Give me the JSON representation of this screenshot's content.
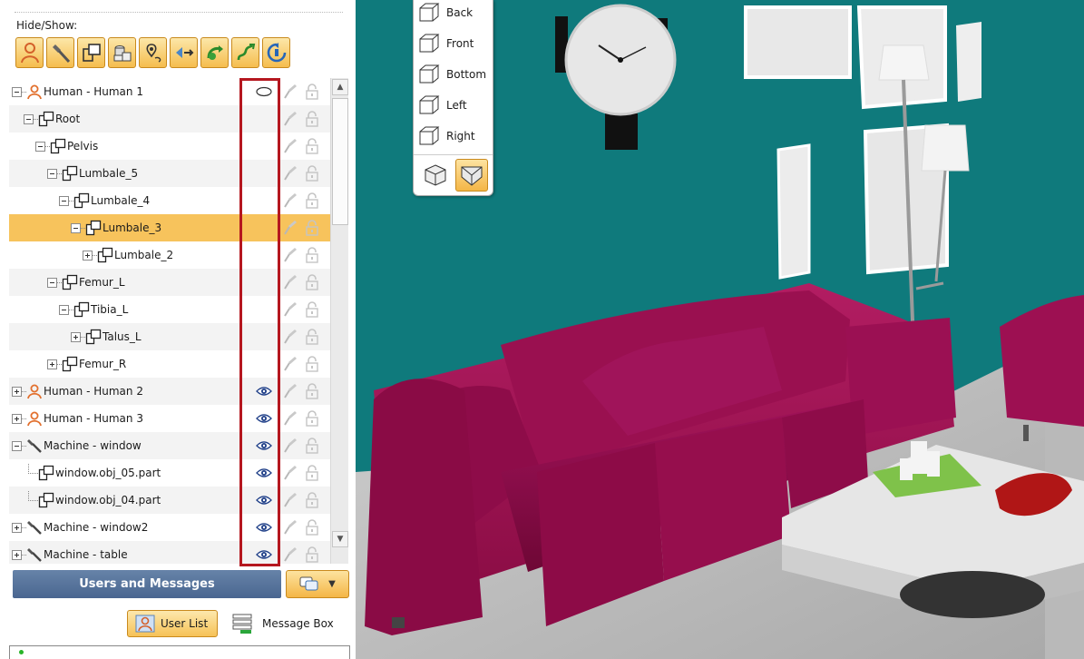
{
  "panel": {
    "hide_show_label": "Hide/Show:",
    "filter_buttons": [
      "human-filter",
      "machine-filter",
      "part-filter",
      "group-filter",
      "location-filter",
      "arrow-filter",
      "motion-filter",
      "path-filter",
      "rotate-filter"
    ]
  },
  "tree": {
    "rows": [
      {
        "label": "Human - Human 1",
        "icon": "human-icon",
        "expander": "minus",
        "vis": "hidden"
      },
      {
        "label": "Root",
        "icon": "part-icon",
        "expander": "minus",
        "vis": "none"
      },
      {
        "label": "Pelvis",
        "icon": "part-icon",
        "expander": "minus",
        "vis": "none"
      },
      {
        "label": "Lumbale_5",
        "icon": "part-icon",
        "expander": "minus",
        "vis": "none"
      },
      {
        "label": "Lumbale_4",
        "icon": "part-icon",
        "expander": "minus",
        "vis": "none"
      },
      {
        "label": "Lumbale_3",
        "icon": "part-icon",
        "expander": "minus",
        "vis": "none",
        "selected": true
      },
      {
        "label": "Lumbale_2",
        "icon": "part-icon",
        "expander": "plus",
        "vis": "none"
      },
      {
        "label": "Femur_L",
        "icon": "part-icon",
        "expander": "minus",
        "vis": "none"
      },
      {
        "label": "Tibia_L",
        "icon": "part-icon",
        "expander": "minus",
        "vis": "none"
      },
      {
        "label": "Talus_L",
        "icon": "part-icon",
        "expander": "plus",
        "vis": "none"
      },
      {
        "label": "Femur_R",
        "icon": "part-icon",
        "expander": "plus",
        "vis": "none"
      },
      {
        "label": "Human - Human 2",
        "icon": "human-icon",
        "expander": "plus",
        "vis": "eye"
      },
      {
        "label": "Human - Human 3",
        "icon": "human-icon",
        "expander": "plus",
        "vis": "eye"
      },
      {
        "label": "Machine - window",
        "icon": "machine-icon",
        "expander": "minus",
        "vis": "eye"
      },
      {
        "label": "window.obj_05.part",
        "icon": "part-icon",
        "expander": "none",
        "vis": "eye"
      },
      {
        "label": "window.obj_04.part",
        "icon": "part-icon",
        "expander": "none",
        "vis": "eye"
      },
      {
        "label": "Machine - window2",
        "icon": "machine-icon",
        "expander": "plus",
        "vis": "eye"
      },
      {
        "label": "Machine - table",
        "icon": "machine-icon",
        "expander": "plus",
        "vis": "eye"
      }
    ]
  },
  "users": {
    "header": "Users and Messages",
    "user_list_label": "User List",
    "message_box_label": "Message Box"
  },
  "view_menu": {
    "items": [
      "Back",
      "Front",
      "Bottom",
      "Left",
      "Right"
    ]
  },
  "colors": {
    "accent": "#f7c35c",
    "header_blue": "#5673a0",
    "highlight_red": "#b5171f",
    "wall": "#0f7a7c",
    "sofa": "#9c1050"
  }
}
